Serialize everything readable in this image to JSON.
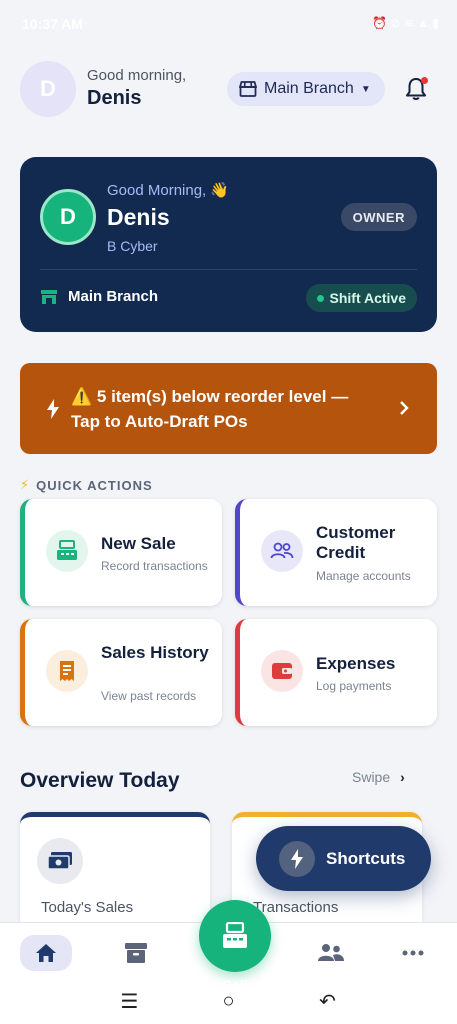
{
  "status_bar": {
    "time": "10:37 AM",
    "icons": "⏰ ⊘ ≋ ▲ ▮"
  },
  "header": {
    "avatar_initial": "D",
    "greeting": "Good morning,",
    "username": "Denis",
    "branch_selector": "Main Branch"
  },
  "hero": {
    "avatar_initial": "D",
    "greeting": "Good Morning, 👋",
    "name": "Denis",
    "business": "B Cyber",
    "role_badge": "OWNER",
    "branch": "Main Branch",
    "shift_status": "Shift Active"
  },
  "alert": {
    "text": "⚠️ 5 item(s) below reorder level — Tap to Auto-Draft POs"
  },
  "quick_actions": {
    "title": "QUICK ACTIONS",
    "items": [
      {
        "title": "New Sale",
        "subtitle": "Record transactions",
        "accent": "#1fb27e",
        "icon": "cash-register-icon"
      },
      {
        "title": "Customer Credit",
        "subtitle": "Manage accounts",
        "accent": "#4f46c8",
        "icon": "users-icon"
      },
      {
        "title": "Sales History",
        "subtitle": "View past records",
        "accent": "#d9730d",
        "icon": "receipt-icon"
      },
      {
        "title": "Expenses",
        "subtitle": "Log payments",
        "accent": "#dc3c3c",
        "icon": "wallet-icon"
      }
    ]
  },
  "overview": {
    "title": "Overview Today",
    "swipe_label": "Swipe",
    "cards": [
      {
        "label": "Today's Sales",
        "accent": "#1f3a6b",
        "icon": "money-icon"
      },
      {
        "label": "Transactions",
        "accent": "#f0b030",
        "icon": "receipt-icon"
      }
    ]
  },
  "fab": {
    "label": "Shortcuts"
  },
  "bottom_nav": {
    "items": [
      {
        "label": "Home",
        "active": true
      },
      {
        "label": "Stock"
      },
      {
        "label": "Sell"
      },
      {
        "label": "Staff"
      },
      {
        "label": "More"
      }
    ]
  },
  "colors": {
    "primary_navy": "#132a50",
    "accent_green": "#16b37d",
    "alert_orange": "#b5540c",
    "background": "#f3f4f8"
  }
}
